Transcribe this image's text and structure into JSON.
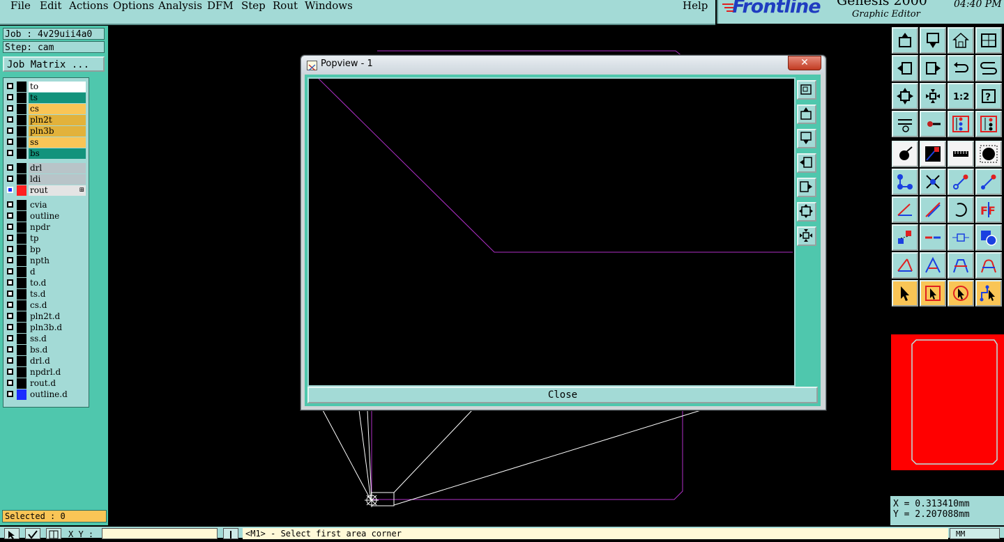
{
  "menu": {
    "items": [
      "File",
      "Edit",
      "Actions",
      "Options",
      "Analysis",
      "DFM",
      "Step",
      "Rout",
      "Windows"
    ],
    "help": "Help"
  },
  "brand": {
    "logo": "Frontline",
    "product": "Genesis 2000",
    "subtitle": "Graphic Editor",
    "clock": "04:40 PM"
  },
  "left": {
    "job": "Job : 4v29uii4a0",
    "step": "Step: cam",
    "job_matrix": "Job Matrix ...",
    "selected": "Selected : 0"
  },
  "layers": [
    {
      "name": "to",
      "color": "#ffffff"
    },
    {
      "name": "ts",
      "color": "#13937c"
    },
    {
      "name": "cs",
      "color": "#f9c556"
    },
    {
      "name": "pln2t",
      "color": "#e2b23b"
    },
    {
      "name": "pln3b",
      "color": "#e2b23b"
    },
    {
      "name": "ss",
      "color": "#f9c556"
    },
    {
      "name": "bs",
      "color": "#13937c"
    },
    {
      "name": "drl",
      "color": "#b8c4c8"
    },
    {
      "name": "ldi",
      "color": "#b8c4c8"
    },
    {
      "name": "rout",
      "color": "#e4e4e4",
      "active": true,
      "swatch": "#ff2020"
    },
    {
      "name": "cvia",
      "color": "#a3dad6"
    },
    {
      "name": "outline",
      "color": "#a3dad6"
    },
    {
      "name": "npdr",
      "color": "#a3dad6"
    },
    {
      "name": "tp",
      "color": "#a3dad6"
    },
    {
      "name": "bp",
      "color": "#a3dad6"
    },
    {
      "name": "npth",
      "color": "#a3dad6"
    },
    {
      "name": "d",
      "color": "#a3dad6"
    },
    {
      "name": "to.d",
      "color": "#a3dad6"
    },
    {
      "name": "ts.d",
      "color": "#a3dad6"
    },
    {
      "name": "cs.d",
      "color": "#a3dad6"
    },
    {
      "name": "pln2t.d",
      "color": "#a3dad6"
    },
    {
      "name": "pln3b.d",
      "color": "#a3dad6"
    },
    {
      "name": "ss.d",
      "color": "#a3dad6"
    },
    {
      "name": "bs.d",
      "color": "#a3dad6"
    },
    {
      "name": "drl.d",
      "color": "#a3dad6"
    },
    {
      "name": "npdrl.d",
      "color": "#a3dad6"
    },
    {
      "name": "rout.d",
      "color": "#a3dad6"
    },
    {
      "name": "outline.d",
      "color": "#a3dad6",
      "swatch": "#1a2cff"
    }
  ],
  "popup": {
    "title": "Popview - 1",
    "close_x": "✕",
    "close_label": "Close"
  },
  "coords": {
    "x": "X = 0.313410mm",
    "y": "Y = 2.207088mm"
  },
  "bottom": {
    "xy_label": "X Y :",
    "prompt": "<M1> - Select first area corner",
    "units": "MM"
  },
  "colors": {
    "panel": "#a3dad6",
    "teal": "#4fc7ad",
    "outline_magenta": "#b030c8",
    "highlight_orange": "#f9c556"
  }
}
